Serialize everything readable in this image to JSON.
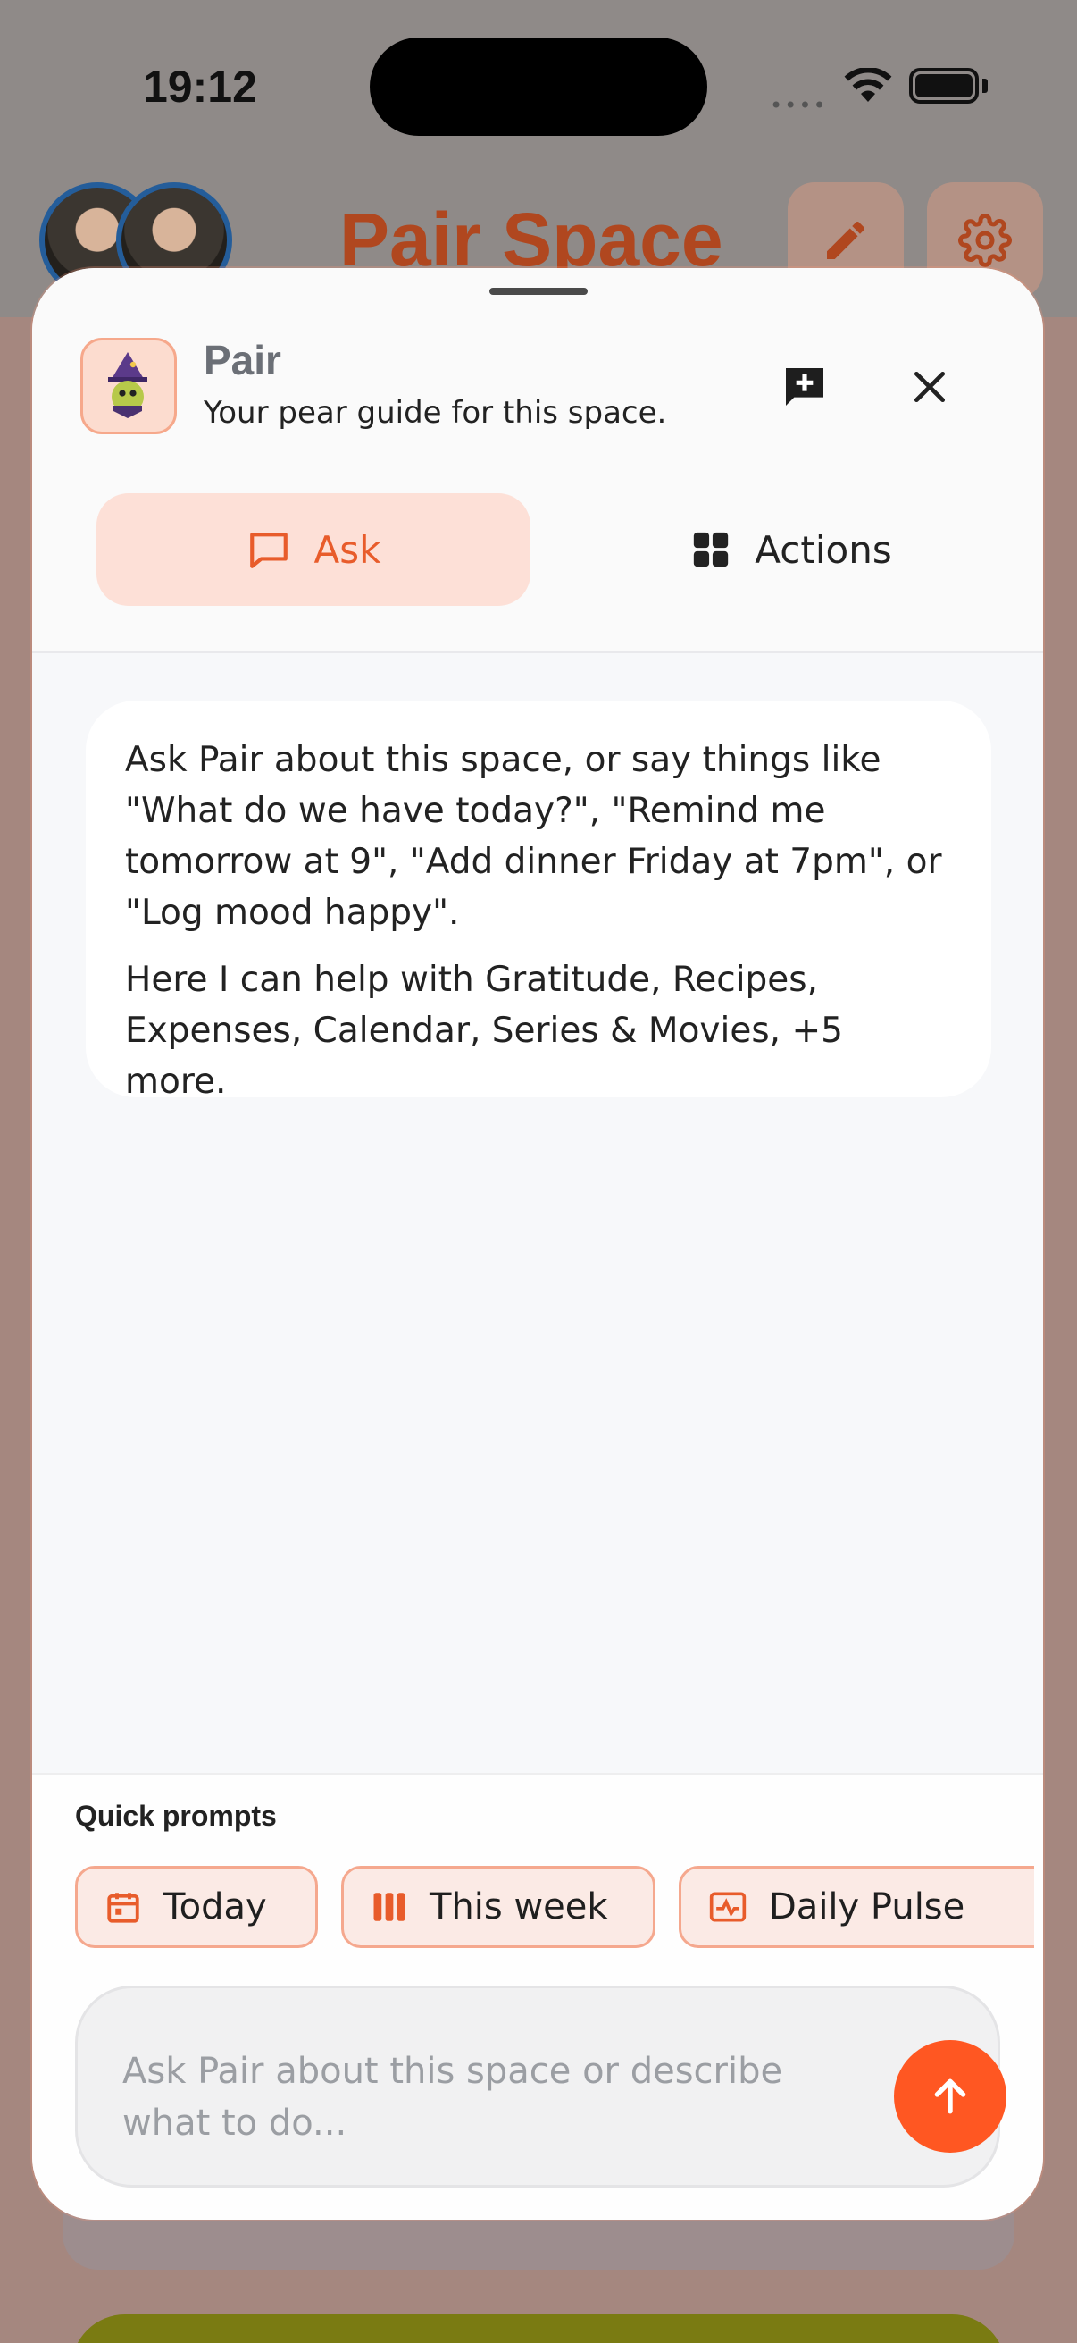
{
  "status_bar": {
    "time": "19:12",
    "signal": "••••"
  },
  "background": {
    "title": "Pair Space"
  },
  "assistant": {
    "name": "Pair",
    "tagline": "Your pear guide for this space."
  },
  "tabs": [
    {
      "label": "Ask",
      "icon": "chat-bubble-icon",
      "active": true
    },
    {
      "label": "Actions",
      "icon": "grid-icon",
      "active": false
    }
  ],
  "message": {
    "paragraph_1": "Ask Pair about this space, or say things like \"What do we have today?\", \"Remind me tomorrow at 9\", \"Add dinner Friday at 7pm\", or \"Log mood happy\".",
    "paragraph_2": "Here I can help with Gratitude, Recipes, Expenses, Calendar, Series & Movies, +5 more."
  },
  "quick_prompts": {
    "label": "Quick prompts",
    "items": [
      {
        "label": "Today",
        "icon": "calendar-icon"
      },
      {
        "label": "This week",
        "icon": "week-bars-icon"
      },
      {
        "label": "Daily Pulse",
        "icon": "pulse-icon"
      }
    ]
  },
  "composer": {
    "placeholder": "Ask Pair about this space or describe what to do..."
  },
  "colors": {
    "accent": "#ff5722",
    "accent_soft": "#fde0d7",
    "chip_border": "#f5a88e"
  }
}
